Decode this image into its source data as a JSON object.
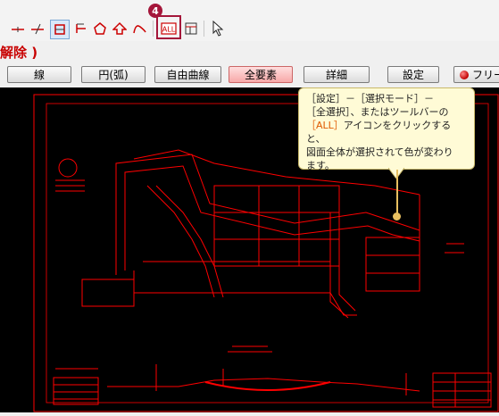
{
  "toolbar": {
    "step_number": "4",
    "all_icon_label": "ALL",
    "icons": [
      "line-tick-icon",
      "diagonal-tick-icon",
      "select-rect-icon",
      "point-line-icon",
      "pentagon-icon",
      "arrow-shape-icon",
      "curve-icon",
      "all-select-icon",
      "table-icon",
      "pointer-icon"
    ]
  },
  "mode": {
    "title": "解除 )",
    "buttons": [
      {
        "label": "線",
        "active": false
      },
      {
        "label": "円(弧)",
        "active": false
      },
      {
        "label": "自由曲線",
        "active": false
      },
      {
        "label": "全要素",
        "active": true
      },
      {
        "label": "詳細",
        "active": false
      },
      {
        "label": "設定",
        "active": false
      }
    ],
    "free_label": "フリー"
  },
  "callout": {
    "line1": "［設定］－［選択モード］－",
    "line2": "［全選択］、またはツールバーの",
    "line3_highlight": "［ALL］",
    "line3_rest": "アイコンをクリックすると、",
    "line4": "図面全体が選択されて色が変わり",
    "line5": "ます。"
  },
  "colors": {
    "accent": "#a4163a",
    "selected_drawing": "#ff0000",
    "canvas": "#000000",
    "callout_bg": "#fffbd6"
  }
}
